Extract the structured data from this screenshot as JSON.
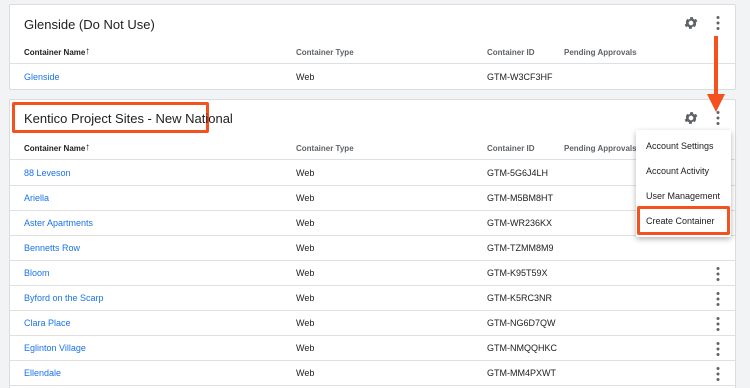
{
  "accounts": [
    {
      "title": "Glenside (Do Not Use)",
      "headers": {
        "name": "Container Name",
        "type": "Container Type",
        "id": "Container ID",
        "pending": "Pending Approvals"
      },
      "containers": [
        {
          "name": "Glenside",
          "type": "Web",
          "id": "GTM-W3CF3HF"
        }
      ]
    },
    {
      "title": "Kentico Project Sites - New National",
      "headers": {
        "name": "Container Name",
        "type": "Container Type",
        "id": "Container ID",
        "pending": "Pending Approvals"
      },
      "containers": [
        {
          "name": "88 Leveson",
          "type": "Web",
          "id": "GTM-5G6J4LH"
        },
        {
          "name": "Ariella",
          "type": "Web",
          "id": "GTM-M5BM8HT"
        },
        {
          "name": "Aster Apartments",
          "type": "Web",
          "id": "GTM-WR236KX"
        },
        {
          "name": "Bennetts Row",
          "type": "Web",
          "id": "GTM-TZMM8M9"
        },
        {
          "name": "Bloom",
          "type": "Web",
          "id": "GTM-K95T59X"
        },
        {
          "name": "Byford on the Scarp",
          "type": "Web",
          "id": "GTM-K5RC3NR"
        },
        {
          "name": "Clara Place",
          "type": "Web",
          "id": "GTM-NG6D7QW"
        },
        {
          "name": "Eglinton Village",
          "type": "Web",
          "id": "GTM-NMQQHKC"
        },
        {
          "name": "Ellendale",
          "type": "Web",
          "id": "GTM-MM4PXWT"
        }
      ]
    }
  ],
  "menu": {
    "items": [
      "Account Settings",
      "Account Activity",
      "User Management",
      "Create Container"
    ]
  },
  "colors": {
    "accent": "#1a73e8",
    "highlight": "#f4511e"
  }
}
